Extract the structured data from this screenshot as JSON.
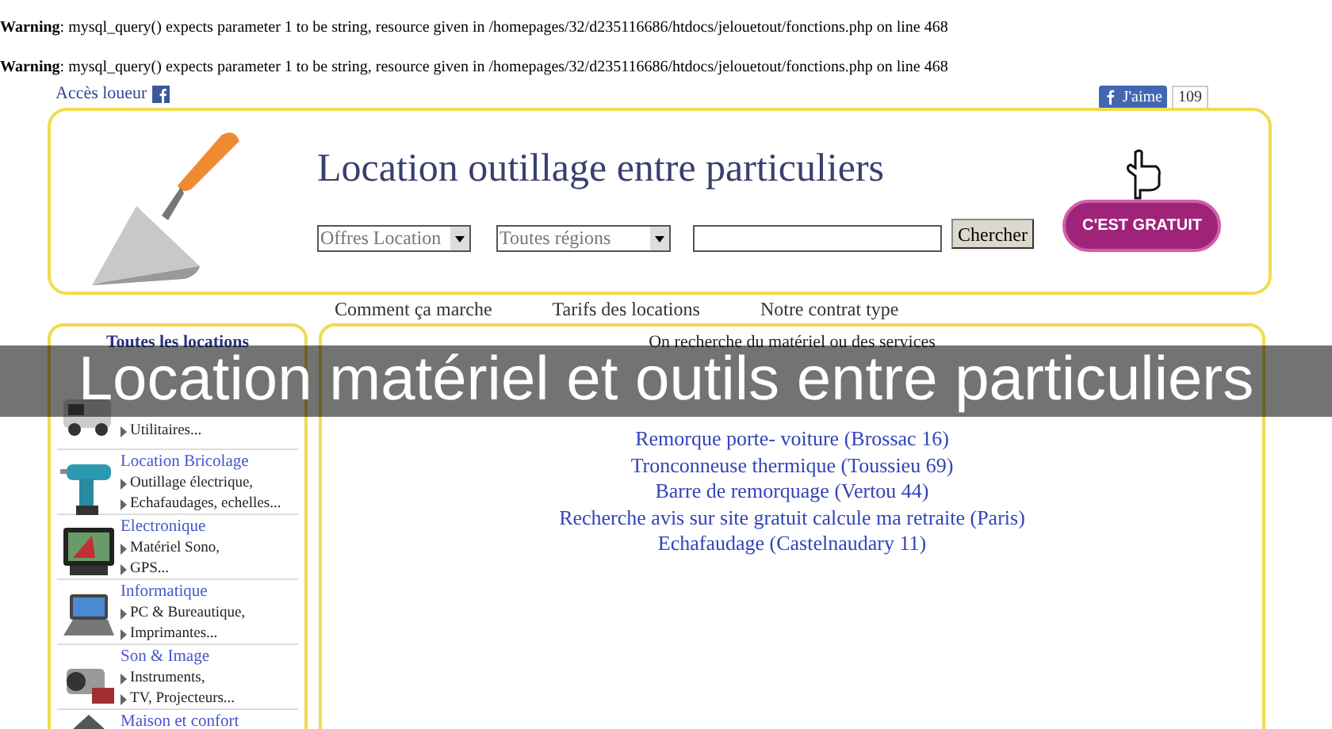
{
  "warnings": [
    {
      "label": "Warning",
      "message": ": mysql_query() expects parameter 1 to be string, resource given in /homepages/32/d235116686/htdocs/jelouetout/fonctions.php on line 468"
    },
    {
      "label": "Warning",
      "message": ": mysql_query() expects parameter 1 to be string, resource given in /homepages/32/d235116686/htdocs/jelouetout/fonctions.php on line 468"
    }
  ],
  "owner_link": "Accès loueur",
  "like_button": {
    "label": "J'aime",
    "count": "109"
  },
  "header": {
    "title": "Location outillage entre particuliers",
    "offer_select": "Offres Location",
    "region_select": "Toutes régions",
    "search_button": "Chercher",
    "cta": "C'EST GRATUIT"
  },
  "nav": [
    "Comment ça marche",
    "Tarifs des locations",
    "Notre contrat type"
  ],
  "sidebar": {
    "title": "Toutes les locations",
    "categories": [
      {
        "kind": "vehicle",
        "links": [
          "Utilitaires..."
        ]
      },
      {
        "kind": "drill",
        "title": "Location Bricolage",
        "links": [
          "Outillage électrique,",
          "Echafaudages, echelles..."
        ]
      },
      {
        "kind": "monitor",
        "title": "Electronique",
        "links": [
          "Matériel Sono,",
          "GPS..."
        ]
      },
      {
        "kind": "laptop",
        "title": "Informatique",
        "links": [
          "PC & Bureautique,",
          "Imprimantes..."
        ]
      },
      {
        "kind": "camera",
        "title": "Son & Image",
        "links": [
          "Instruments,",
          "TV, Projecteurs..."
        ]
      },
      {
        "kind": "house",
        "title": "Maison et confort"
      }
    ]
  },
  "requests": {
    "title": "On recherche du matériel ou des services",
    "items": [
      "Remorque porte- voiture (Brossac 16)",
      "Tronconneuse thermique (Toussieu 69)",
      "Barre de remorquage (Vertou 44)",
      "Recherche avis sur site gratuit calcule ma retraite (Paris)",
      "Echafaudage (Castelnaudary 11)"
    ]
  },
  "banner": "Location matériel et outils entre particuliers"
}
